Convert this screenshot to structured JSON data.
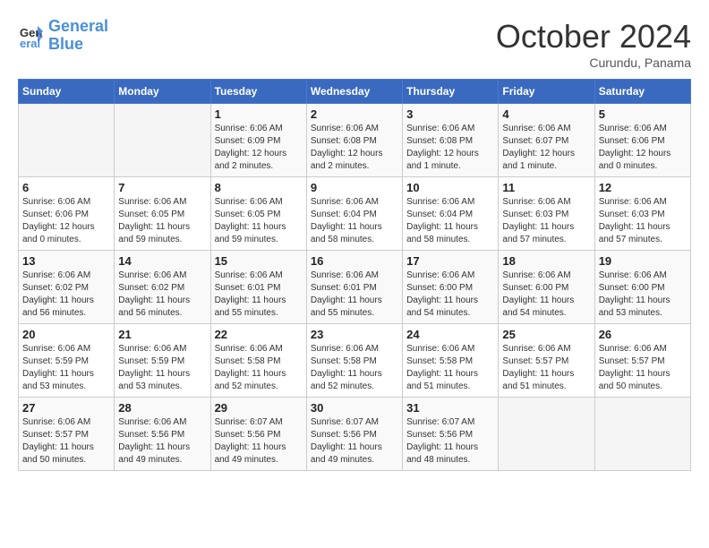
{
  "header": {
    "logo_line1": "General",
    "logo_line2": "Blue",
    "month": "October 2024",
    "location": "Curundu, Panama"
  },
  "weekdays": [
    "Sunday",
    "Monday",
    "Tuesday",
    "Wednesday",
    "Thursday",
    "Friday",
    "Saturday"
  ],
  "weeks": [
    [
      {
        "day": "",
        "info": ""
      },
      {
        "day": "",
        "info": ""
      },
      {
        "day": "1",
        "info": "Sunrise: 6:06 AM\nSunset: 6:09 PM\nDaylight: 12 hours\nand 2 minutes."
      },
      {
        "day": "2",
        "info": "Sunrise: 6:06 AM\nSunset: 6:08 PM\nDaylight: 12 hours\nand 2 minutes."
      },
      {
        "day": "3",
        "info": "Sunrise: 6:06 AM\nSunset: 6:08 PM\nDaylight: 12 hours\nand 1 minute."
      },
      {
        "day": "4",
        "info": "Sunrise: 6:06 AM\nSunset: 6:07 PM\nDaylight: 12 hours\nand 1 minute."
      },
      {
        "day": "5",
        "info": "Sunrise: 6:06 AM\nSunset: 6:06 PM\nDaylight: 12 hours\nand 0 minutes."
      }
    ],
    [
      {
        "day": "6",
        "info": "Sunrise: 6:06 AM\nSunset: 6:06 PM\nDaylight: 12 hours\nand 0 minutes."
      },
      {
        "day": "7",
        "info": "Sunrise: 6:06 AM\nSunset: 6:05 PM\nDaylight: 11 hours\nand 59 minutes."
      },
      {
        "day": "8",
        "info": "Sunrise: 6:06 AM\nSunset: 6:05 PM\nDaylight: 11 hours\nand 59 minutes."
      },
      {
        "day": "9",
        "info": "Sunrise: 6:06 AM\nSunset: 6:04 PM\nDaylight: 11 hours\nand 58 minutes."
      },
      {
        "day": "10",
        "info": "Sunrise: 6:06 AM\nSunset: 6:04 PM\nDaylight: 11 hours\nand 58 minutes."
      },
      {
        "day": "11",
        "info": "Sunrise: 6:06 AM\nSunset: 6:03 PM\nDaylight: 11 hours\nand 57 minutes."
      },
      {
        "day": "12",
        "info": "Sunrise: 6:06 AM\nSunset: 6:03 PM\nDaylight: 11 hours\nand 57 minutes."
      }
    ],
    [
      {
        "day": "13",
        "info": "Sunrise: 6:06 AM\nSunset: 6:02 PM\nDaylight: 11 hours\nand 56 minutes."
      },
      {
        "day": "14",
        "info": "Sunrise: 6:06 AM\nSunset: 6:02 PM\nDaylight: 11 hours\nand 56 minutes."
      },
      {
        "day": "15",
        "info": "Sunrise: 6:06 AM\nSunset: 6:01 PM\nDaylight: 11 hours\nand 55 minutes."
      },
      {
        "day": "16",
        "info": "Sunrise: 6:06 AM\nSunset: 6:01 PM\nDaylight: 11 hours\nand 55 minutes."
      },
      {
        "day": "17",
        "info": "Sunrise: 6:06 AM\nSunset: 6:00 PM\nDaylight: 11 hours\nand 54 minutes."
      },
      {
        "day": "18",
        "info": "Sunrise: 6:06 AM\nSunset: 6:00 PM\nDaylight: 11 hours\nand 54 minutes."
      },
      {
        "day": "19",
        "info": "Sunrise: 6:06 AM\nSunset: 6:00 PM\nDaylight: 11 hours\nand 53 minutes."
      }
    ],
    [
      {
        "day": "20",
        "info": "Sunrise: 6:06 AM\nSunset: 5:59 PM\nDaylight: 11 hours\nand 53 minutes."
      },
      {
        "day": "21",
        "info": "Sunrise: 6:06 AM\nSunset: 5:59 PM\nDaylight: 11 hours\nand 53 minutes."
      },
      {
        "day": "22",
        "info": "Sunrise: 6:06 AM\nSunset: 5:58 PM\nDaylight: 11 hours\nand 52 minutes."
      },
      {
        "day": "23",
        "info": "Sunrise: 6:06 AM\nSunset: 5:58 PM\nDaylight: 11 hours\nand 52 minutes."
      },
      {
        "day": "24",
        "info": "Sunrise: 6:06 AM\nSunset: 5:58 PM\nDaylight: 11 hours\nand 51 minutes."
      },
      {
        "day": "25",
        "info": "Sunrise: 6:06 AM\nSunset: 5:57 PM\nDaylight: 11 hours\nand 51 minutes."
      },
      {
        "day": "26",
        "info": "Sunrise: 6:06 AM\nSunset: 5:57 PM\nDaylight: 11 hours\nand 50 minutes."
      }
    ],
    [
      {
        "day": "27",
        "info": "Sunrise: 6:06 AM\nSunset: 5:57 PM\nDaylight: 11 hours\nand 50 minutes."
      },
      {
        "day": "28",
        "info": "Sunrise: 6:06 AM\nSunset: 5:56 PM\nDaylight: 11 hours\nand 49 minutes."
      },
      {
        "day": "29",
        "info": "Sunrise: 6:07 AM\nSunset: 5:56 PM\nDaylight: 11 hours\nand 49 minutes."
      },
      {
        "day": "30",
        "info": "Sunrise: 6:07 AM\nSunset: 5:56 PM\nDaylight: 11 hours\nand 49 minutes."
      },
      {
        "day": "31",
        "info": "Sunrise: 6:07 AM\nSunset: 5:56 PM\nDaylight: 11 hours\nand 48 minutes."
      },
      {
        "day": "",
        "info": ""
      },
      {
        "day": "",
        "info": ""
      }
    ]
  ]
}
